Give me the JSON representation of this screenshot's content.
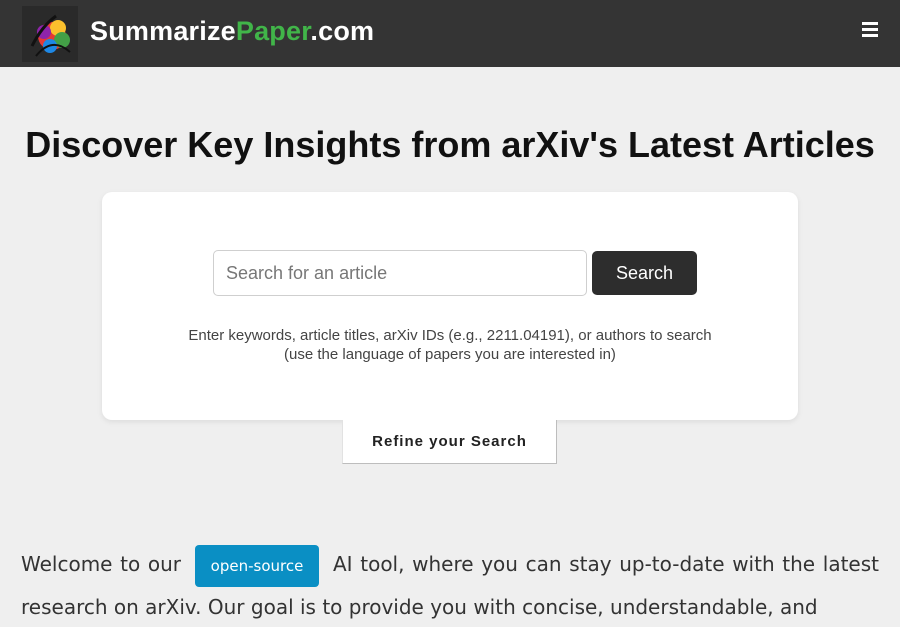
{
  "navbar": {
    "brand_part1": "Summarize",
    "brand_part2": "Paper",
    "brand_part3": ".com",
    "logo_icon": "colorful-brain-logo-icon",
    "menu_icon": "hamburger-menu-icon",
    "background": "#343434",
    "accent": "#41b549"
  },
  "hero": {
    "title": "Discover Key Insights from arXiv's Latest Articles"
  },
  "search": {
    "placeholder": "Search for an article",
    "button_label": "Search",
    "hint_line1": "Enter keywords, article titles, arXiv IDs (e.g., 2211.04191), or authors to search",
    "hint_line2": "(use the language of papers you are interested in)"
  },
  "refine": {
    "label": "Refine your Search"
  },
  "welcome": {
    "text_before": "Welcome to our",
    "badge": "open-source",
    "text_after": "AI tool, where you can stay up-to-date with the latest research on arXiv. Our goal is to provide you with concise, understandable, and",
    "badge_color": "#0a8fc4"
  }
}
